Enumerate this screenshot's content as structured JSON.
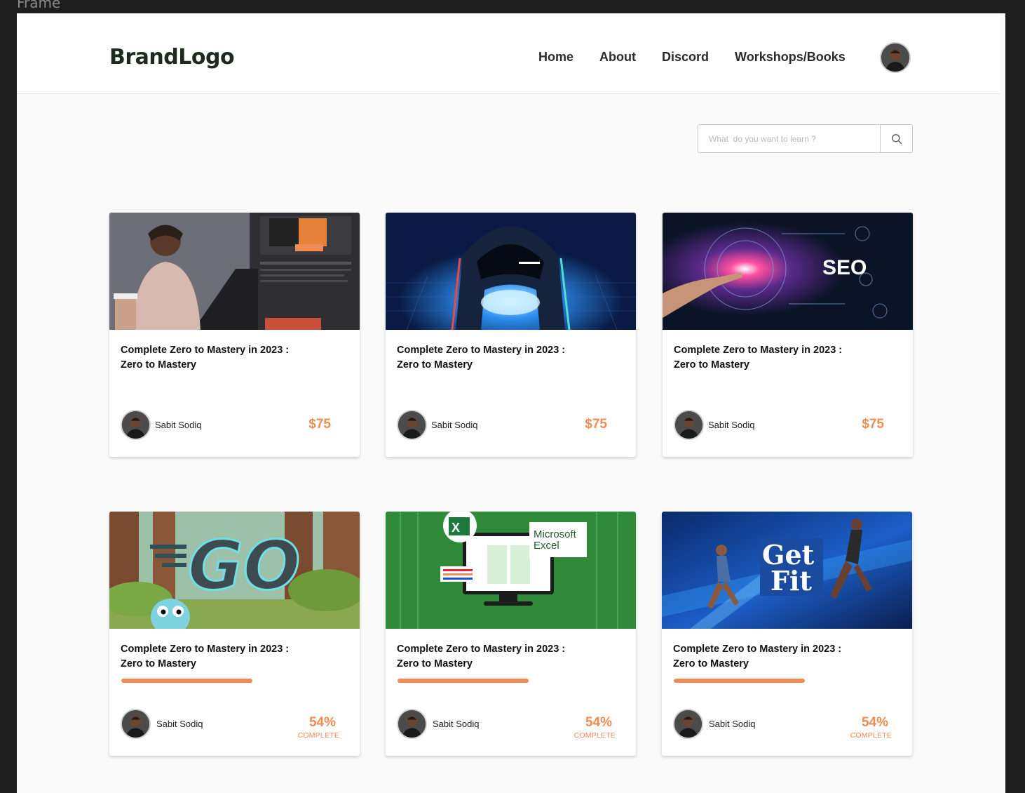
{
  "frame_label": "Frame",
  "navbar": {
    "brand": "BrandLogo",
    "links": [
      "Home",
      "About",
      "Discord",
      "Workshops/Books"
    ]
  },
  "search": {
    "placeholder": "What  do you want to learn ?",
    "icon": "search-icon"
  },
  "courses": [
    {
      "title_line1": "Complete Zero to Mastery in 2023 :",
      "title_line2": "Zero to Mastery",
      "author": "Sabit Sodiq",
      "price": "$75",
      "image": "woman-laptop-tensorflow"
    },
    {
      "title_line1": "Complete Zero to Mastery in 2023 :",
      "title_line2": "Zero to Mastery",
      "author": "Sabit Sodiq",
      "price": "$75",
      "image": "hooded-hacker"
    },
    {
      "title_line1": "Complete Zero to Mastery in 2023 :",
      "title_line2": "Zero to Mastery",
      "author": "Sabit Sodiq",
      "price": "$75",
      "image": "seo-touch",
      "image_text": "SEO"
    }
  ],
  "in_progress": [
    {
      "title_line1": "Complete Zero to Mastery in 2023 :",
      "title_line2": "Zero to Mastery",
      "author": "Sabit Sodiq",
      "percent": "54%",
      "percent_value": 54,
      "status": "COMPLETE",
      "image": "go-gopher-forest",
      "image_text": "GO"
    },
    {
      "title_line1": "Complete Zero to Mastery in 2023 :",
      "title_line2": "Zero to Mastery",
      "author": "Sabit Sodiq",
      "percent": "54%",
      "percent_value": 54,
      "status": "COMPLETE",
      "image": "microsoft-excel",
      "image_text_1": "Microsoft",
      "image_text_2": "Excel"
    },
    {
      "title_line1": "Complete Zero to Mastery in 2023 :",
      "title_line2": "Zero to Mastery",
      "author": "Sabit Sodiq",
      "percent": "54%",
      "percent_value": 54,
      "status": "COMPLETE",
      "image": "get-fit-runners",
      "image_text_1": "Get",
      "image_text_2": "Fit"
    }
  ],
  "colors": {
    "accent": "#f08b52",
    "text": "#111111",
    "page_bg": "#fafafa"
  }
}
